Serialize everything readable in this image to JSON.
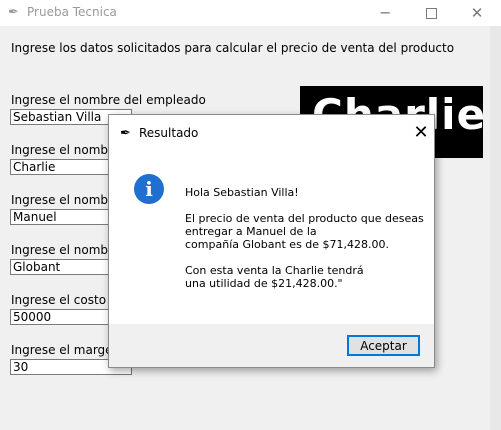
{
  "window": {
    "title": "Prueba Tecnica",
    "icon": "feather-icon",
    "controls": {
      "minimize": "─",
      "close": "✕"
    }
  },
  "form": {
    "instructions": "Ingrese los datos solicitados para calcular el precio de venta del producto",
    "fields": [
      {
        "label": "Ingrese el nombre del empleado",
        "value": "Sebastian Villa"
      },
      {
        "label": "Ingrese el nombre",
        "value": "Charlie"
      },
      {
        "label": "Ingrese el nombre",
        "value": "Manuel"
      },
      {
        "label": "Ingrese el nombre",
        "value": "Globant"
      },
      {
        "label": "Ingrese el costo de",
        "value": "50000"
      },
      {
        "label": "Ingrese el margen",
        "value": "30"
      }
    ]
  },
  "logo": {
    "text": "Charlie"
  },
  "dialog": {
    "title": "Resultado",
    "close": "✕",
    "icon": "info-icon",
    "icon_glyph": "i",
    "greeting": "Hola Sebastian Villa!",
    "paragraph1": [
      "El precio de venta del producto que deseas",
      "entregar a Manuel de la",
      "compañía Globant es de $71,428.00."
    ],
    "paragraph2": [
      "Con esta venta la Charlie tendrá",
      "una utilidad de $21,428.00.\""
    ],
    "accept_label": "Aceptar",
    "accent_color": "#0078d7"
  }
}
